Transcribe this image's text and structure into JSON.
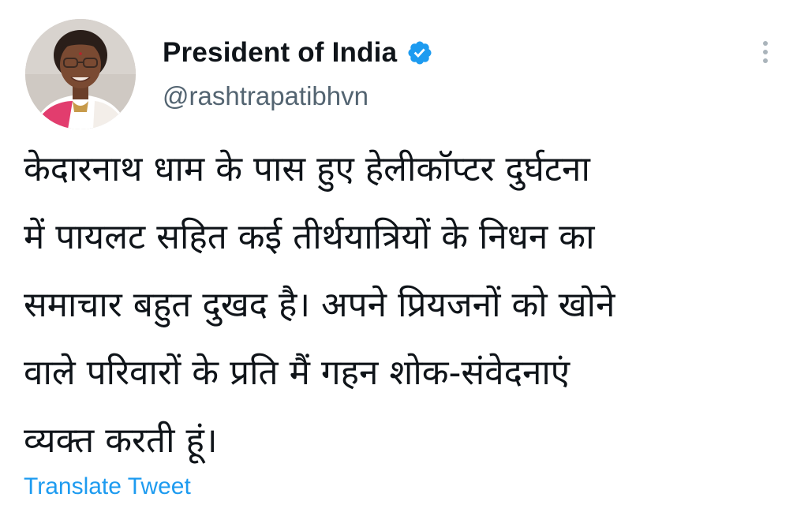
{
  "author": {
    "display_name": "President of India",
    "handle": "@rashtrapatibhvn",
    "verified": true,
    "avatar_icon": "profile-photo"
  },
  "tweet": {
    "lines": [
      "केदारनाथ धाम के पास हुए हेलीकॉप्टर दुर्घटना",
      "में पायलट सहित कई तीर्थयात्रियों के निधन का",
      "समाचार बहुत दुखद है। अपने प्रियजनों को खोने",
      "वाले परिवारों के प्रति मैं गहन शोक-संवेदनाएं",
      "व्यक्त करती हूं।"
    ]
  },
  "actions": {
    "translate_label": "Translate Tweet",
    "more_icon": "more-vertical-icon"
  },
  "colors": {
    "link": "#1d9bf0",
    "handle": "#536471",
    "verified": "#1d9bf0",
    "text": "#0f1419"
  }
}
